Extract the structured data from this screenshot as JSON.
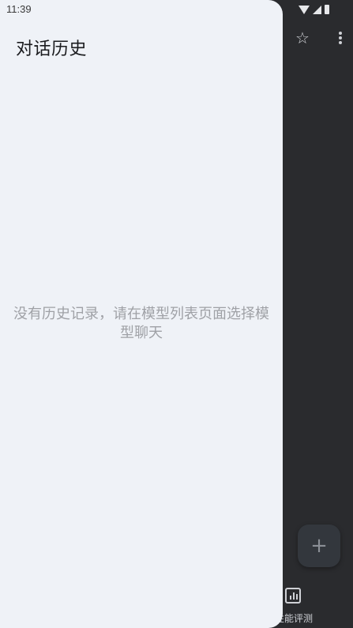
{
  "status_bar": {
    "time": "11:39",
    "icons": [
      "wifi-icon",
      "signal-icon",
      "battery-icon"
    ]
  },
  "drawer": {
    "title": "对话历史",
    "empty_message": "没有历史记录，请在模型列表页面选择模型聊天"
  },
  "background_app": {
    "toolbar_icons": [
      "star-icon",
      "more-vert-icon"
    ],
    "fab_icon": "add-icon",
    "fab_symbol": "+",
    "star_symbol": "☆",
    "bottom_nav": {
      "visible_item_label": "性能评测",
      "visible_item_icon": "bar-chart-icon"
    }
  },
  "colors": {
    "drawer_bg": "#eff2f7",
    "scrim_bg": "#2a2b2e",
    "title_text": "#1b1c1f",
    "empty_text": "#9fa1a6"
  }
}
